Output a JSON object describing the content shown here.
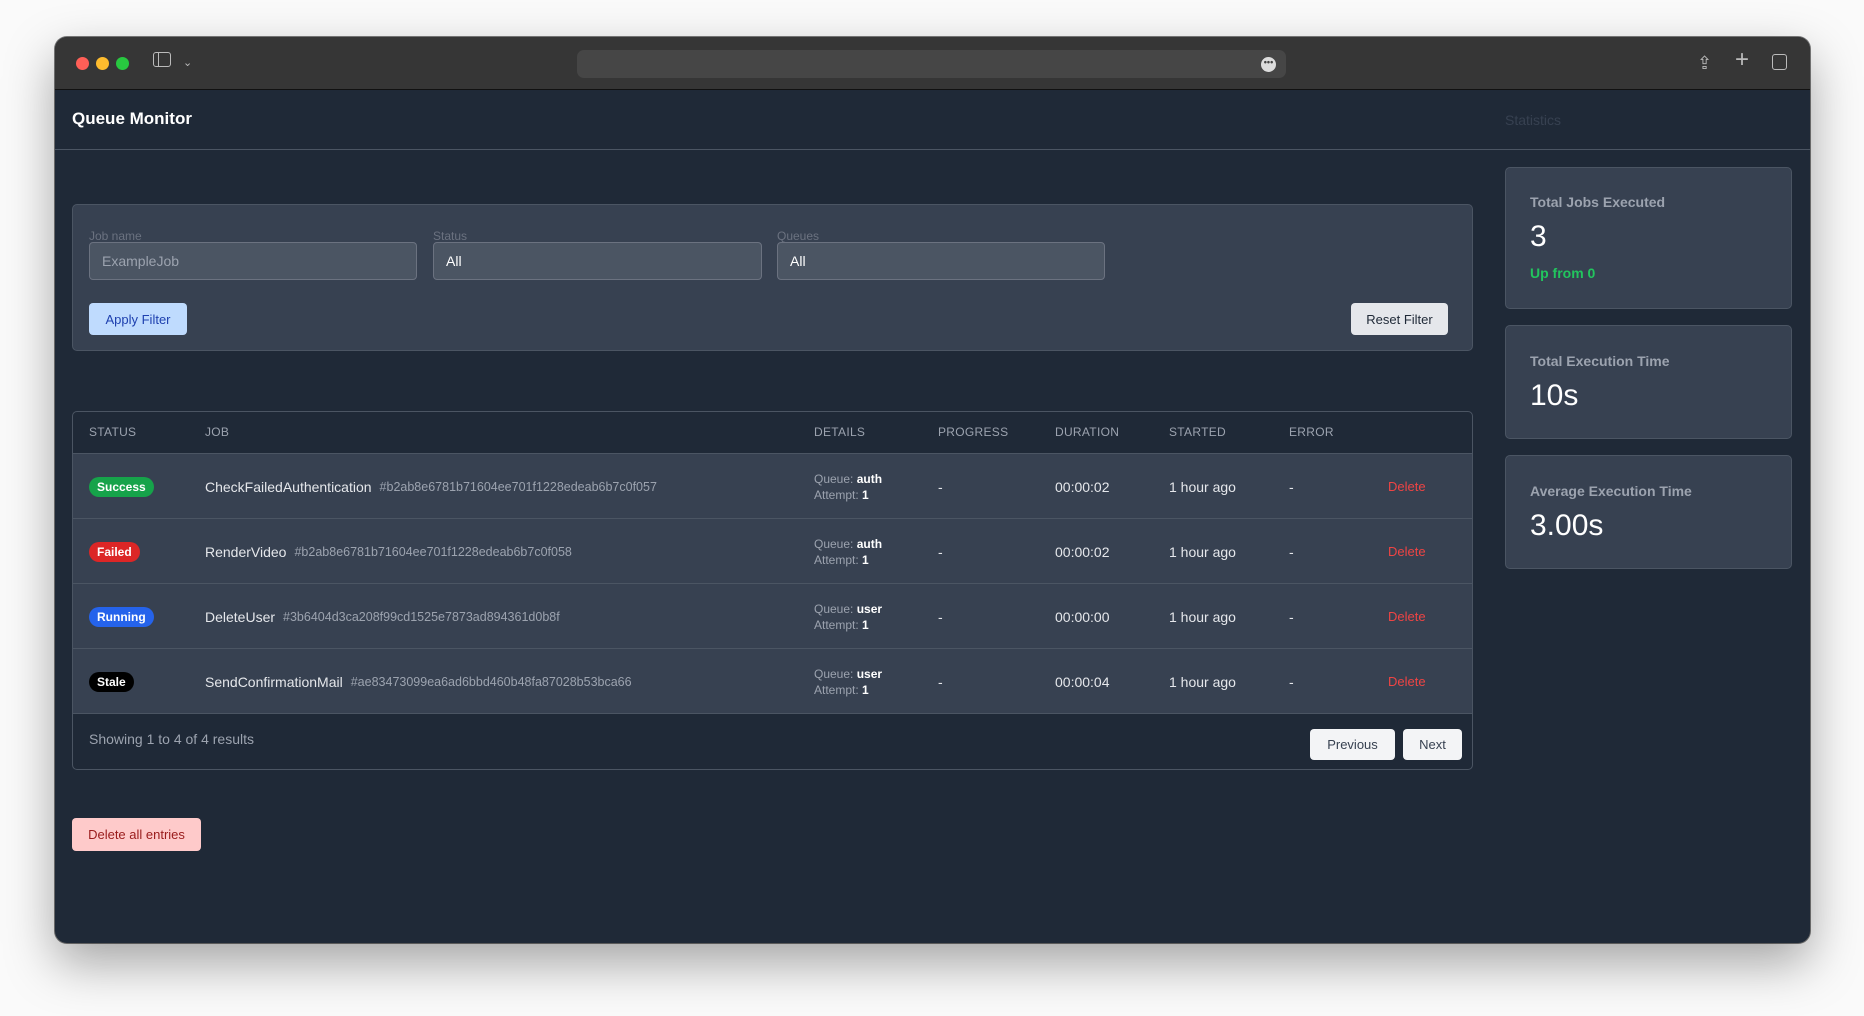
{
  "browser": {
    "icons": [
      "sidebar-icon",
      "chevron-down-icon",
      "more-icon",
      "share-icon",
      "plus-icon",
      "tabs-icon"
    ]
  },
  "header": {
    "title": "Queue Monitor",
    "statistics_label": "Statistics"
  },
  "filters": {
    "job_name": {
      "label": "Job name",
      "placeholder": "ExampleJob"
    },
    "status": {
      "label": "Status",
      "value": "All"
    },
    "queues": {
      "label": "Queues",
      "value": "All"
    },
    "apply_label": "Apply Filter",
    "reset_label": "Reset Filter"
  },
  "table": {
    "columns": [
      "STATUS",
      "JOB",
      "DETAILS",
      "PROGRESS",
      "DURATION",
      "STARTED",
      "ERROR"
    ],
    "rows": [
      {
        "status": "Success",
        "status_color": "#16a34a",
        "job": "CheckFailedAuthentication",
        "hash": "#b2ab8e6781b71604ee701f1228edeab6b7c0f057",
        "queue_label": "Queue:",
        "queue": "auth",
        "attempt_label": "Attempt:",
        "attempt": "1",
        "progress": "-",
        "duration": "00:00:02",
        "started": "1 hour ago",
        "error": "-",
        "delete": "Delete"
      },
      {
        "status": "Failed",
        "status_color": "#dc2626",
        "job": "RenderVideo",
        "hash": "#b2ab8e6781b71604ee701f1228edeab6b7c0f058",
        "queue_label": "Queue:",
        "queue": "auth",
        "attempt_label": "Attempt:",
        "attempt": "1",
        "progress": "-",
        "duration": "00:00:02",
        "started": "1 hour ago",
        "error": "-",
        "delete": "Delete"
      },
      {
        "status": "Running",
        "status_color": "#2563eb",
        "job": "DeleteUser",
        "hash": "#3b6404d3ca208f99cd1525e7873ad894361d0b8f",
        "queue_label": "Queue:",
        "queue": "user",
        "attempt_label": "Attempt:",
        "attempt": "1",
        "progress": "-",
        "duration": "00:00:00",
        "started": "1 hour ago",
        "error": "-",
        "delete": "Delete"
      },
      {
        "status": "Stale",
        "status_color": "#000000",
        "job": "SendConfirmationMail",
        "hash": "#ae83473099ea6ad6bbd460b48fa87028b53bca66",
        "queue_label": "Queue:",
        "queue": "user",
        "attempt_label": "Attempt:",
        "attempt": "1",
        "progress": "-",
        "duration": "00:00:04",
        "started": "1 hour ago",
        "error": "-",
        "delete": "Delete"
      }
    ],
    "summary": "Showing 1 to 4 of 4 results",
    "previous_label": "Previous",
    "next_label": "Next"
  },
  "delete_all_label": "Delete all entries",
  "stats": [
    {
      "title": "Total Jobs Executed",
      "value": "3",
      "trend": "Up from 0"
    },
    {
      "title": "Total Execution Time",
      "value": "10s"
    },
    {
      "title": "Average Execution Time",
      "value": "3.00s"
    }
  ]
}
